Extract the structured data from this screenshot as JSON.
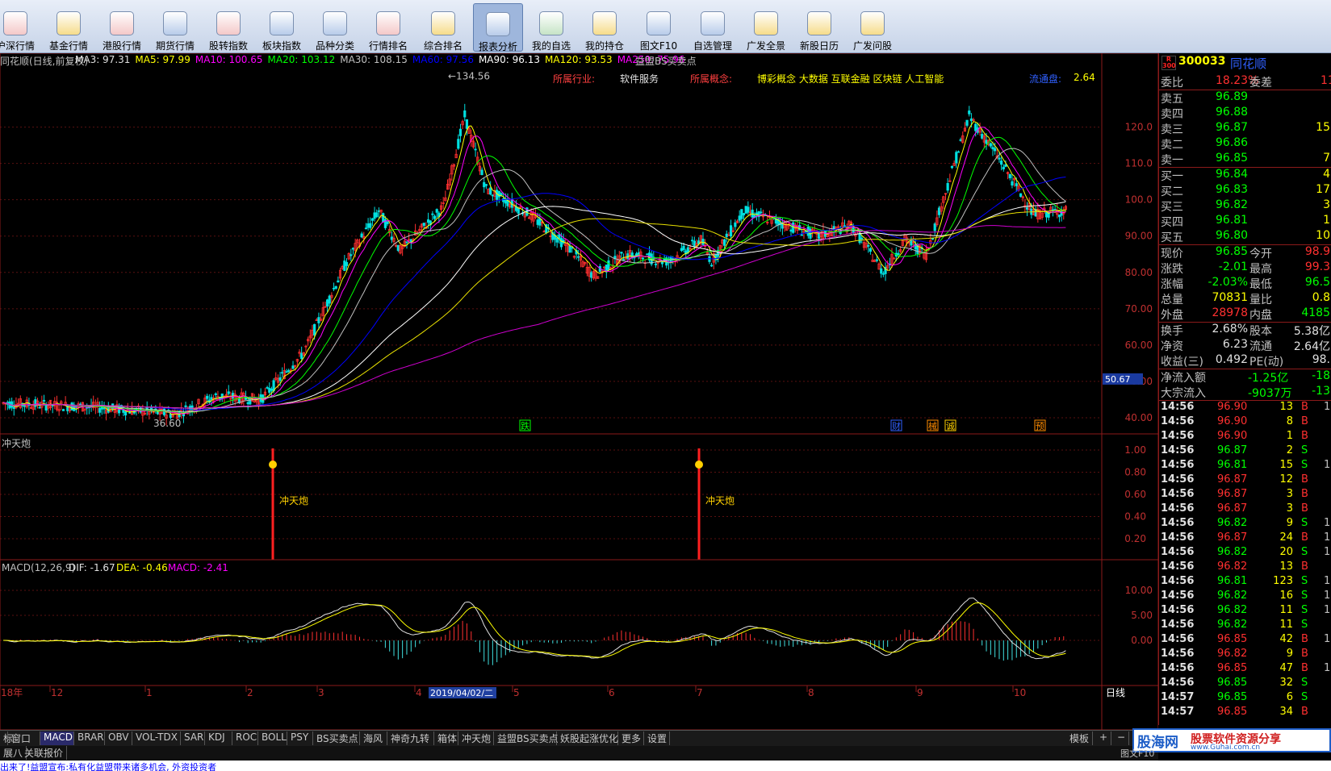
{
  "toolbar": {
    "items": [
      "沪深行情",
      "基金行情",
      "港股行情",
      "期货行情",
      "股转指数",
      "板块指数",
      "品种分类",
      "行情排名",
      "综合排名",
      "报表分析",
      "我的自选",
      "我的持仓",
      "图文F10",
      "自选管理",
      "广发全景",
      "新股日历",
      "广发问股"
    ]
  },
  "header": {
    "title": "同花顺(日线,前复权)",
    "mas": [
      {
        "label": "MA3: 97.31",
        "color": "#e0e0e0"
      },
      {
        "label": "MA5: 97.99",
        "color": "#ffff00"
      },
      {
        "label": "MA10: 100.65",
        "color": "#ff00ff"
      },
      {
        "label": "MA20: 103.12",
        "color": "#00ff00"
      },
      {
        "label": "MA30: 108.15",
        "color": "#c0c0c0"
      },
      {
        "label": "MA60: 97.56",
        "color": "#0000ff"
      },
      {
        "label": "MA90: 96.13",
        "color": "#ffffff"
      },
      {
        "label": "MA120: 93.53",
        "color": "#ffff00"
      },
      {
        "label": "MA250: 75.96",
        "color": "#ff00ff"
      }
    ],
    "indicator": "益盟BS买卖点",
    "industry_label": "所属行业:",
    "industry": "软件服务",
    "concept_label": "所属概念:",
    "concepts": "博彩概念 大数据 互联金融 区块链 人工智能",
    "float_label": "流通盘:",
    "float_value": "2.64"
  },
  "chart_data": [
    {
      "type": "candlestick",
      "title": "同花顺(日线,前复权)",
      "yaxis": [
        "120.0",
        "110.0",
        "100.0",
        "90.00",
        "80.00",
        "70.00",
        "60.00",
        "50.00",
        "40.00"
      ],
      "ylim": [
        36,
        135
      ],
      "high_label": "134.56",
      "low_label": "36.60",
      "current_label": "50.67",
      "events": [
        "跌",
        "财",
        "械",
        "诚",
        "预"
      ],
      "xaxis": [
        "18年",
        "12",
        "1",
        "2",
        "3",
        "4",
        "5",
        "6",
        "7",
        "8",
        "9",
        "10"
      ],
      "selected_date": "2019/04/02/二",
      "period": "日线"
    },
    {
      "type": "signal",
      "title": "冲天炮",
      "yaxis": [
        "1.00",
        "0.80",
        "0.60",
        "0.40",
        "0.20"
      ],
      "label": "冲天炮"
    },
    {
      "type": "macd",
      "title": "MACD(12,26,9)",
      "dif": "DIF: -1.67",
      "dea": "DEA: -0.46",
      "macd": "MACD: -2.41",
      "yaxis": [
        "10.00",
        "5.00",
        "0.00"
      ]
    }
  ],
  "stock": {
    "code": "300033",
    "name": "同花顺",
    "badge_top": "R",
    "badge_bottom": "300"
  },
  "orderbook": {
    "wb_label": "委比",
    "wb_value": "18.23%",
    "wc_label": "委差",
    "wc_value": "11",
    "asks": [
      {
        "label": "卖五",
        "price": "96.89",
        "vol": ""
      },
      {
        "label": "卖四",
        "price": "96.88",
        "vol": ""
      },
      {
        "label": "卖三",
        "price": "96.87",
        "vol": "15"
      },
      {
        "label": "卖二",
        "price": "96.86",
        "vol": ""
      },
      {
        "label": "卖一",
        "price": "96.85",
        "vol": "7"
      }
    ],
    "bids": [
      {
        "label": "买一",
        "price": "96.84",
        "vol": "4"
      },
      {
        "label": "买二",
        "price": "96.83",
        "vol": "17"
      },
      {
        "label": "买三",
        "price": "96.82",
        "vol": "3"
      },
      {
        "label": "买四",
        "price": "96.81",
        "vol": "1"
      },
      {
        "label": "买五",
        "price": "96.80",
        "vol": "10"
      }
    ]
  },
  "quote": [
    {
      "l1": "现价",
      "v1": "96.85",
      "c1": "#00ff00",
      "l2": "今开",
      "v2": "98.9",
      "c2": "#ff3030"
    },
    {
      "l1": "涨跌",
      "v1": "-2.01",
      "c1": "#00ff00",
      "l2": "最高",
      "v2": "99.3",
      "c2": "#ff3030"
    },
    {
      "l1": "涨幅",
      "v1": "-2.03%",
      "c1": "#00ff00",
      "l2": "最低",
      "v2": "96.5",
      "c2": "#00ff00"
    },
    {
      "l1": "总量",
      "v1": "70831",
      "c1": "#ffff00",
      "l2": "量比",
      "v2": "0.8",
      "c2": "#ffff00"
    },
    {
      "l1": "外盘",
      "v1": "28978",
      "c1": "#ff3030",
      "l2": "内盘",
      "v2": "4185",
      "c2": "#00ff00"
    }
  ],
  "info": [
    {
      "l1": "换手",
      "v1": "2.68%",
      "l2": "股本",
      "v2": "5.38亿"
    },
    {
      "l1": "净资",
      "v1": "6.23",
      "l2": "流通",
      "v2": "2.64亿"
    },
    {
      "l1": "收益(三)",
      "v1": "0.492",
      "l2": "PE(动)",
      "v2": "98."
    }
  ],
  "flows": [
    {
      "label": "净流入额",
      "v1": "-1.25亿",
      "v2": "-18"
    },
    {
      "label": "大宗流入",
      "v1": "-9037万",
      "v2": "-13"
    }
  ],
  "ticks": [
    {
      "t": "14:56",
      "p": "96.90",
      "v": "13",
      "s": "B",
      "n": "1"
    },
    {
      "t": "14:56",
      "p": "96.90",
      "v": "8",
      "s": "B",
      "n": ""
    },
    {
      "t": "14:56",
      "p": "96.90",
      "v": "1",
      "s": "B",
      "n": ""
    },
    {
      "t": "14:56",
      "p": "96.87",
      "v": "2",
      "s": "S",
      "n": ""
    },
    {
      "t": "14:56",
      "p": "96.81",
      "v": "15",
      "s": "S",
      "n": "1"
    },
    {
      "t": "14:56",
      "p": "96.87",
      "v": "12",
      "s": "B",
      "n": ""
    },
    {
      "t": "14:56",
      "p": "96.87",
      "v": "3",
      "s": "B",
      "n": ""
    },
    {
      "t": "14:56",
      "p": "96.87",
      "v": "3",
      "s": "B",
      "n": ""
    },
    {
      "t": "14:56",
      "p": "96.82",
      "v": "9",
      "s": "S",
      "n": "1"
    },
    {
      "t": "14:56",
      "p": "96.87",
      "v": "24",
      "s": "B",
      "n": "1"
    },
    {
      "t": "14:56",
      "p": "96.82",
      "v": "20",
      "s": "S",
      "n": "1"
    },
    {
      "t": "14:56",
      "p": "96.82",
      "v": "13",
      "s": "B",
      "n": ""
    },
    {
      "t": "14:56",
      "p": "96.81",
      "v": "123",
      "s": "S",
      "n": "1"
    },
    {
      "t": "14:56",
      "p": "96.82",
      "v": "16",
      "s": "S",
      "n": "1"
    },
    {
      "t": "14:56",
      "p": "96.82",
      "v": "11",
      "s": "S",
      "n": "1"
    },
    {
      "t": "14:56",
      "p": "96.82",
      "v": "11",
      "s": "S",
      "n": ""
    },
    {
      "t": "14:56",
      "p": "96.85",
      "v": "42",
      "s": "B",
      "n": "1"
    },
    {
      "t": "14:56",
      "p": "96.82",
      "v": "9",
      "s": "B",
      "n": ""
    },
    {
      "t": "14:56",
      "p": "96.85",
      "v": "47",
      "s": "B",
      "n": "1"
    },
    {
      "t": "14:56",
      "p": "96.85",
      "v": "32",
      "s": "S",
      "n": ""
    },
    {
      "t": "14:57",
      "p": "96.85",
      "v": "6",
      "s": "S",
      "n": ""
    },
    {
      "t": "14:57",
      "p": "96.85",
      "v": "34",
      "s": "B",
      "n": ""
    }
  ],
  "tabs": [
    "标",
    "窗口",
    "MACD",
    "BRAR",
    "OBV",
    "VOL-TDX",
    "SAR",
    "KDJ",
    "ROC",
    "BOLL",
    "PSY",
    "BS买卖点",
    "海风",
    "神奇九转",
    "箱体",
    "冲天炮",
    "益盟BS买卖点",
    "妖股起涨优化",
    "更多",
    "设置"
  ],
  "tabs_right": [
    "模板",
    "+",
    "−"
  ],
  "tabs2": [
    "展八",
    "关联报价"
  ],
  "side_tab": "图文F10",
  "footer": "出来了!益盟宣布:私有化益盟带来诸多机会, 外资投资者",
  "logo": {
    "main": "股海网",
    "slogan": "股票软件资源分享",
    "url": "www.Guhai.com.cn"
  }
}
